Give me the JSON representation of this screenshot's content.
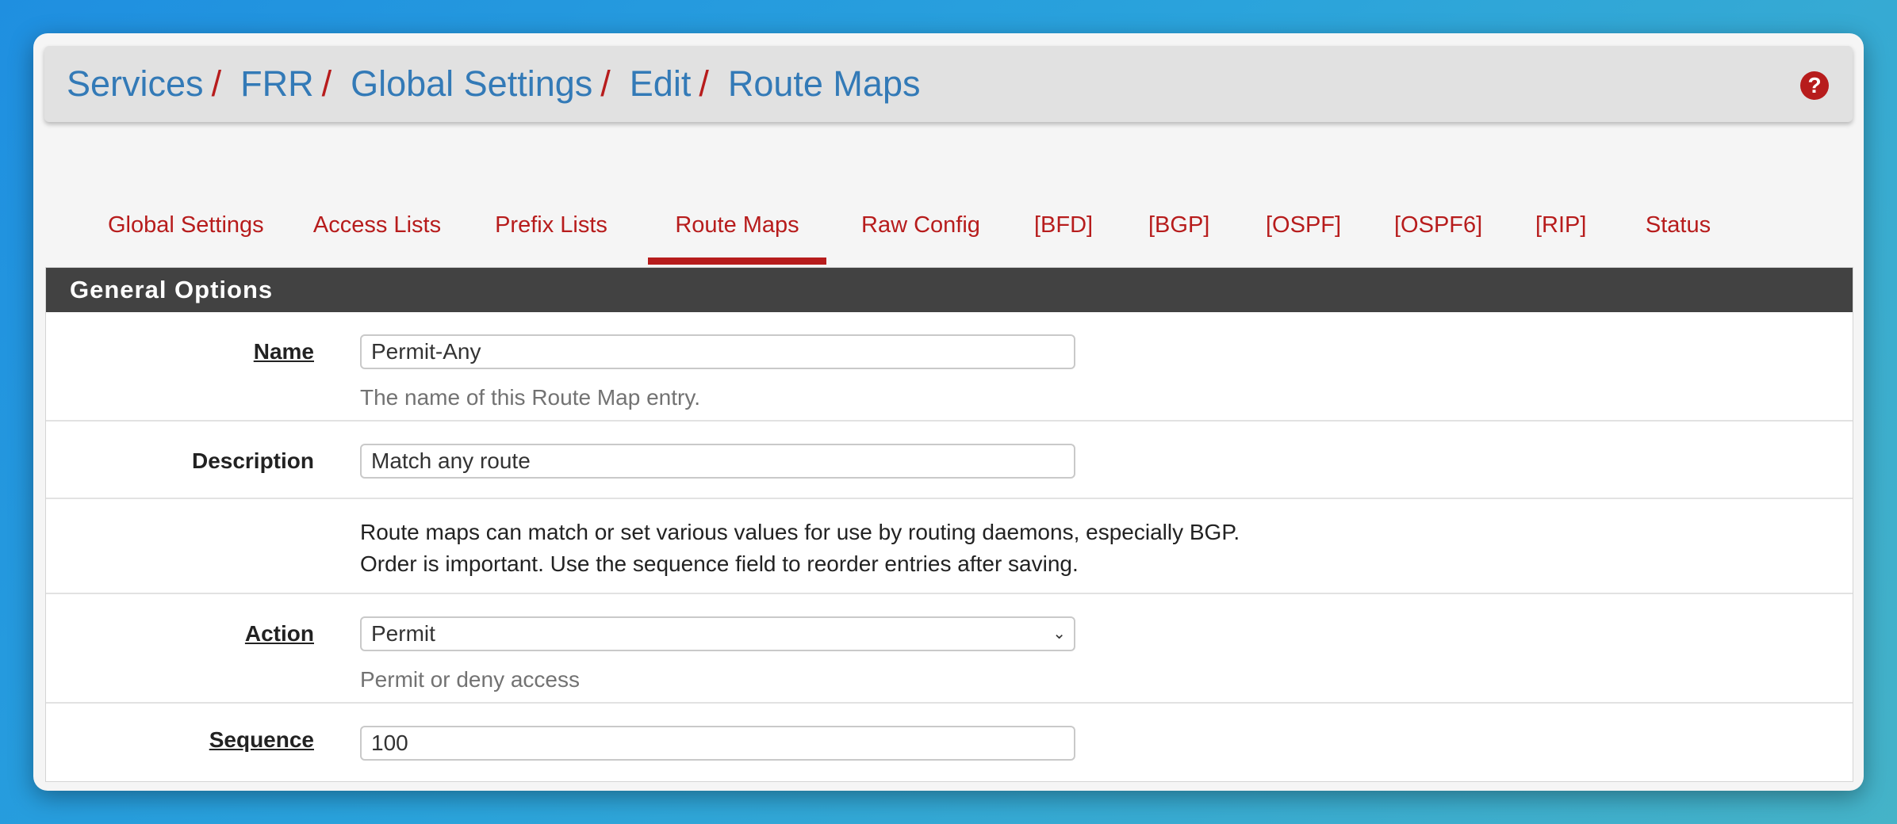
{
  "breadcrumb": [
    {
      "label": "Services"
    },
    {
      "label": "FRR"
    },
    {
      "label": "Global Settings"
    },
    {
      "label": "Edit"
    },
    {
      "label": "Route Maps"
    }
  ],
  "breadcrumb_separator": "/",
  "help_icon": {
    "name": "question-circle-icon",
    "glyph": "?",
    "color": "#b71c1c"
  },
  "tabs": [
    {
      "label": "Global Settings",
      "active": false
    },
    {
      "label": "Access Lists",
      "active": false
    },
    {
      "label": "Prefix Lists",
      "active": false
    },
    {
      "label": "Route Maps",
      "active": true
    },
    {
      "label": "Raw Config",
      "active": false
    },
    {
      "label": "[BFD]",
      "active": false
    },
    {
      "label": "[BGP]",
      "active": false
    },
    {
      "label": "[OSPF]",
      "active": false
    },
    {
      "label": "[OSPF6]",
      "active": false
    },
    {
      "label": "[RIP]",
      "active": false
    },
    {
      "label": "Status",
      "active": false
    }
  ],
  "panel": {
    "title": "General Options",
    "name": {
      "label": "Name",
      "value": "Permit-Any",
      "help": "The name of this Route Map entry."
    },
    "description": {
      "label": "Description",
      "value": "Match any route"
    },
    "info": {
      "line1": "Route maps can match or set various values for use by routing daemons, especially BGP.",
      "line2": "Order is important. Use the sequence field to reorder entries after saving."
    },
    "action": {
      "label": "Action",
      "value": "Permit",
      "help": "Permit or deny access"
    },
    "sequence": {
      "label": "Sequence",
      "value": "100"
    }
  },
  "colors": {
    "accent": "#b71c1c",
    "link": "#337ab7",
    "panel_heading": "#424242"
  }
}
